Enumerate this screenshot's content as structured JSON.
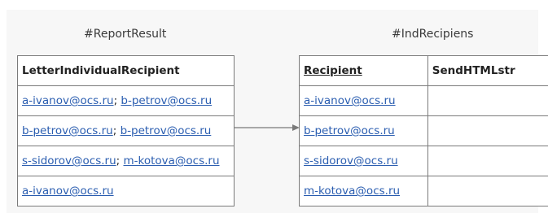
{
  "captions": {
    "left": "#ReportResult",
    "right": "#IndRecipiens"
  },
  "report_result": {
    "header": "LetterIndividualRecipient",
    "rows": [
      {
        "first": "a-ivanov@ocs.ru",
        "sep": "; ",
        "second": "b-petrov@ocs.ru"
      },
      {
        "first": "b-petrov@ocs.ru",
        "sep": "; ",
        "second": "b-petrov@ocs.ru"
      },
      {
        "first": "s-sidorov@ocs.ru",
        "sep": "; ",
        "second": "m-kotova@ocs.ru"
      },
      {
        "first": "a-ivanov@ocs.ru",
        "sep": "",
        "second": ""
      }
    ]
  },
  "ind_recipiens": {
    "headers": [
      "Recipient",
      "SendHTMLstr"
    ],
    "rows": [
      {
        "recipient": "a-ivanov@ocs.ru",
        "send_html": ""
      },
      {
        "recipient": "b-petrov@ocs.ru",
        "send_html": ""
      },
      {
        "recipient": "s-sidorov@ocs.ru",
        "send_html": ""
      },
      {
        "recipient": "m-kotova@ocs.ru",
        "send_html": ""
      }
    ]
  },
  "colors": {
    "link": "#2a5db0",
    "border": "#7a7a7a",
    "arrow": "#7a7a7a",
    "panel": "#f7f7f7"
  }
}
